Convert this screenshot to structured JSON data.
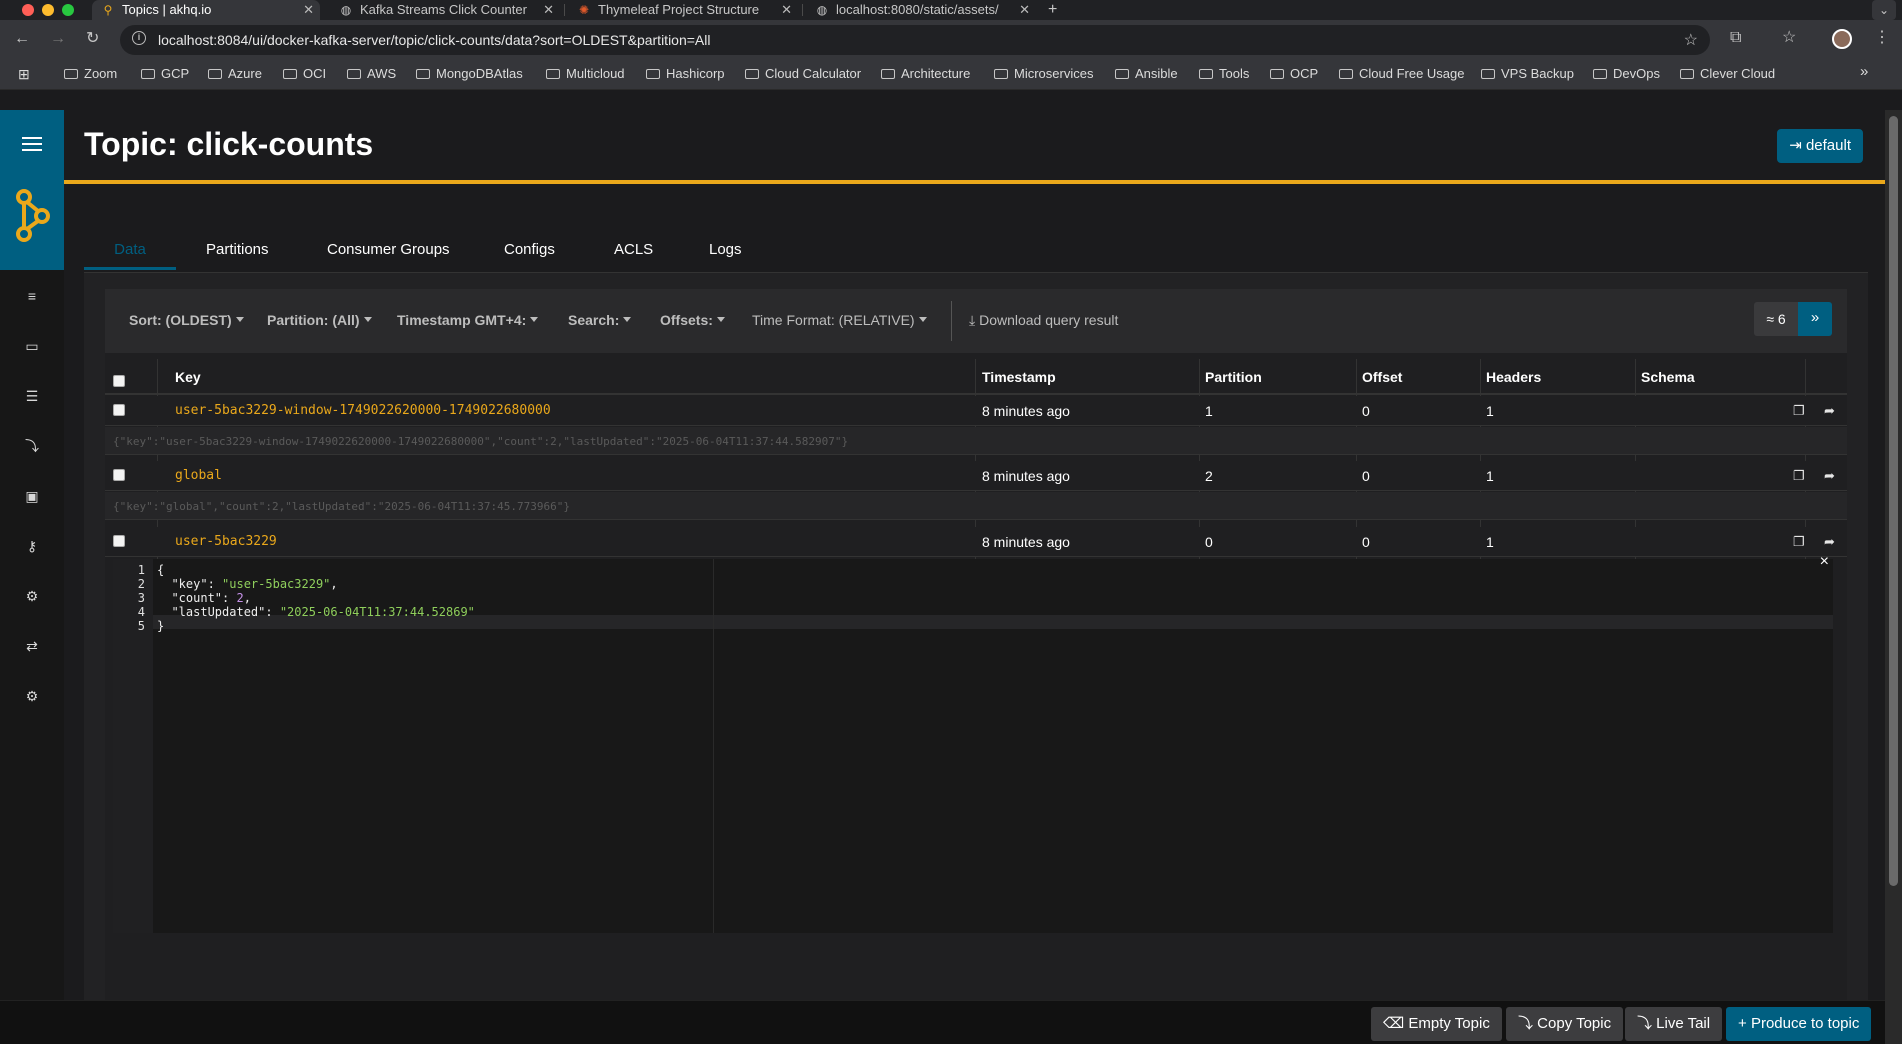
{
  "browser": {
    "tabs": [
      {
        "title": "Topics | akhq.io",
        "active": true
      },
      {
        "title": "Kafka Streams Click Counter",
        "active": false
      },
      {
        "title": "Thymeleaf Project Structure",
        "active": false
      },
      {
        "title": "localhost:8080/static/assets/",
        "active": false
      }
    ],
    "new_tab": "+",
    "url": "localhost:8084/ui/docker-kafka-server/topic/click-counts/data?sort=OLDEST&partition=All",
    "bookmarks": [
      "Zoom",
      "GCP",
      "Azure",
      "OCI",
      "AWS",
      "MongoDBAtlas",
      "Multicloud",
      "Hashicorp",
      "Cloud Calculator",
      "Architecture",
      "Microservices",
      "Ansible",
      "Tools",
      "OCP",
      "Cloud Free Usage",
      "VPS Backup",
      "DevOps",
      "Clever Cloud"
    ],
    "bookmarks_more": "»"
  },
  "page": {
    "title": "Topic: click-counts",
    "cluster_button": "default"
  },
  "tabs": [
    "Data",
    "Partitions",
    "Consumer Groups",
    "Configs",
    "ACLS",
    "Logs"
  ],
  "filters": {
    "sort": "Sort: (OLDEST)",
    "partition": "Partition: (All)",
    "timestamp": "Timestamp GMT+4:",
    "search": "Search:",
    "offsets": "Offsets:",
    "time_format": "Time Format: (RELATIVE)",
    "download": "Download query result",
    "count": "≈ 6",
    "next": "»"
  },
  "table": {
    "columns": [
      "Key",
      "Timestamp",
      "Partition",
      "Offset",
      "Headers",
      "Schema"
    ],
    "rows": [
      {
        "key": "user-5bac3229-window-1749022620000-1749022680000",
        "timestamp": "8 minutes ago",
        "partition": "1",
        "offset": "0",
        "headers": "1",
        "schema": "",
        "preview": "{\"key\":\"user-5bac3229-window-1749022620000-1749022680000\",\"count\":2,\"lastUpdated\":\"2025-06-04T11:37:44.582907\"}"
      },
      {
        "key": "global",
        "timestamp": "8 minutes ago",
        "partition": "2",
        "offset": "0",
        "headers": "1",
        "schema": "",
        "preview": "{\"key\":\"global\",\"count\":2,\"lastUpdated\":\"2025-06-04T11:37:45.773966\"}"
      },
      {
        "key": "user-5bac3229",
        "timestamp": "8 minutes ago",
        "partition": "0",
        "offset": "0",
        "headers": "1",
        "schema": ""
      }
    ]
  },
  "editor": {
    "line_numbers": [
      "1",
      "2",
      "3",
      "4",
      "5"
    ],
    "close": "×",
    "lines": {
      "l1": "{",
      "l2_key": "\"key\"",
      "l2_val": "\"user-5bac3229\"",
      "l3_key": "\"count\"",
      "l3_val": "2",
      "l4_key": "\"lastUpdated\"",
      "l4_val": "\"2025-06-04T11:37:44.52869\"",
      "l5": "}"
    }
  },
  "actions": {
    "empty_topic": "Empty Topic",
    "copy_topic": "Copy Topic",
    "live_tail": "Live Tail",
    "produce": "Produce to topic"
  },
  "colors": {
    "accent": "#005f81",
    "gold": "#eaa81b",
    "background": "#1b1b1d"
  }
}
